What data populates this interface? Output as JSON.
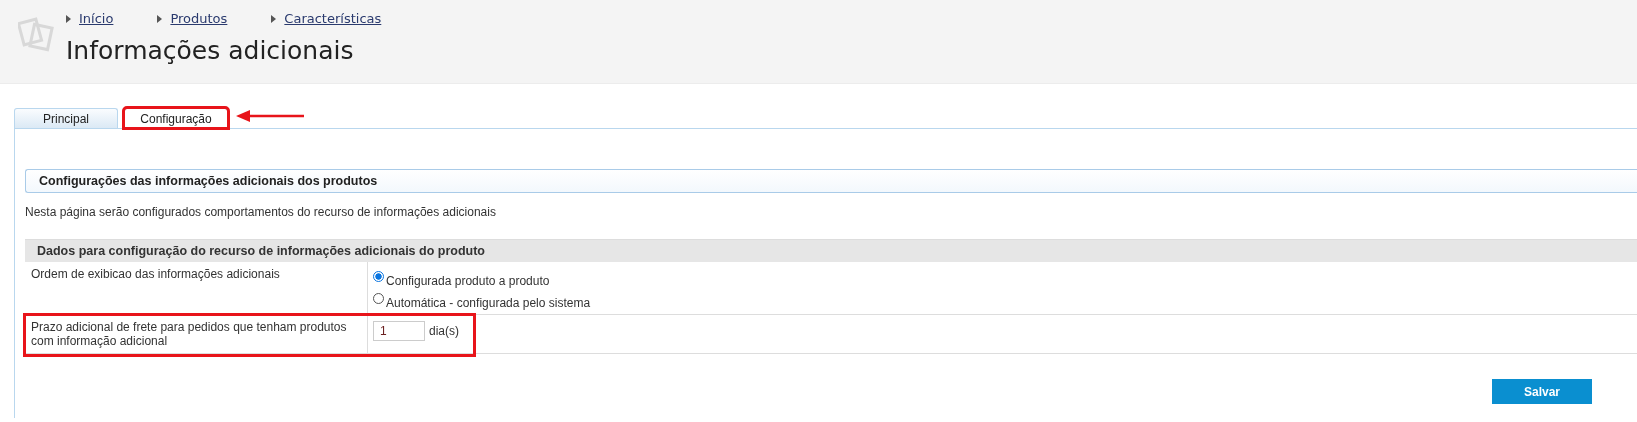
{
  "breadcrumbs": [
    "Início",
    "Produtos",
    "Características"
  ],
  "title": "Informações adicionais",
  "tabs": [
    {
      "label": "Principal",
      "selected": false,
      "highlighted": false
    },
    {
      "label": "Configuração",
      "selected": true,
      "highlighted": true
    }
  ],
  "section_title": "Configurações das informações adicionais dos produtos",
  "description": "Nesta página serão configurados comportamentos do recurso de informações adicionais",
  "table": {
    "heading": "Dados para configuração do recurso de informações adicionais do produto",
    "rows": [
      {
        "kind": "radio",
        "label": "Ordem de exibicao das informações adicionais",
        "highlighted": false,
        "options": [
          {
            "label": "Configurada produto a produto",
            "selected": true
          },
          {
            "label": "Automática - configurada pelo sistema",
            "selected": false
          }
        ]
      },
      {
        "kind": "number",
        "label": "Prazo adicional de frete para pedidos que tenham produtos com informação adicional",
        "highlighted": true,
        "value": "1",
        "unit": "dia(s)"
      }
    ]
  },
  "save_button": "Salvar"
}
